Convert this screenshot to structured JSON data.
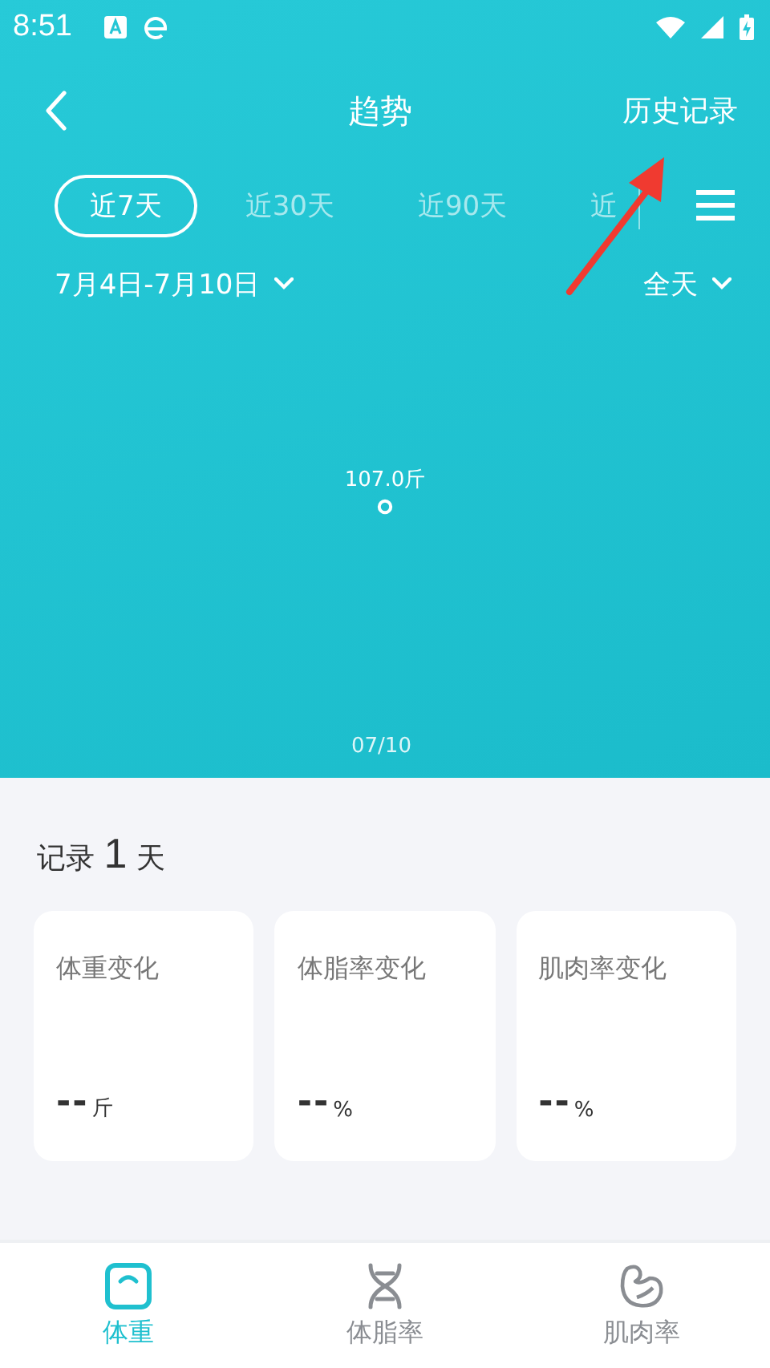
{
  "status_bar": {
    "time": "8:51"
  },
  "header": {
    "title": "趋势",
    "action": "历史记录"
  },
  "ranges": [
    {
      "label": "近7天",
      "selected": true
    },
    {
      "label": "近30天",
      "selected": false
    },
    {
      "label": "近90天",
      "selected": false
    },
    {
      "label": "近",
      "selected": false
    }
  ],
  "filters": {
    "date_range": "7月4日-7月10日",
    "time_of_day": "全天"
  },
  "chart": {
    "point_label": "107.0斤",
    "x_label": "07/10"
  },
  "summary": {
    "prefix": "记录",
    "count": "1",
    "suffix": "天"
  },
  "cards": [
    {
      "title": "体重变化",
      "value": "--",
      "unit": "斤"
    },
    {
      "title": "体脂率变化",
      "value": "--",
      "unit": "%"
    },
    {
      "title": "肌肉率变化",
      "value": "--",
      "unit": "%"
    }
  ],
  "bottom_nav": [
    {
      "label": "体重",
      "kind": "scale",
      "selected": true
    },
    {
      "label": "体脂率",
      "kind": "fat",
      "selected": false
    },
    {
      "label": "肌肉率",
      "kind": "muscle",
      "selected": false
    }
  ]
}
